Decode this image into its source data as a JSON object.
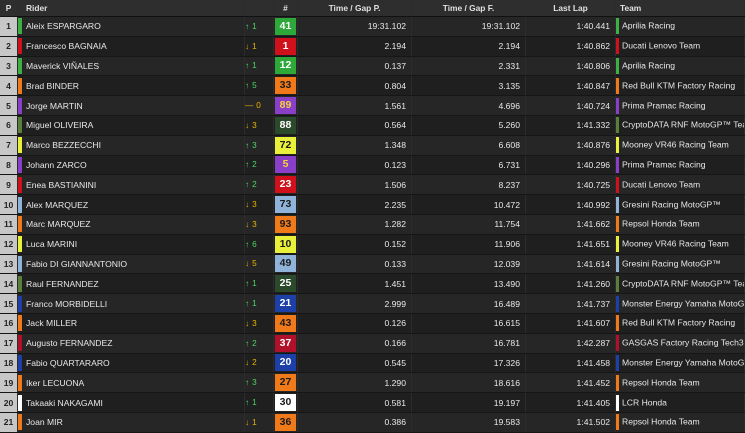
{
  "header": {
    "pos": "P",
    "rider": "Rider",
    "num": "#",
    "gap_p": "Time / Gap P.",
    "gap_f": "Time / Gap F.",
    "last": "Last Lap",
    "team": "Team"
  },
  "colors": {
    "up": "#4cd964",
    "down": "#f0b400"
  },
  "rows": [
    {
      "pos": "1",
      "rider": "Aleix ESPARGARO",
      "dir": "up",
      "chg": "1",
      "num": "41",
      "num_bg": "#2fa83a",
      "num_fg": "#ffffff",
      "gap_p": "19:31.102",
      "gap_f": "19:31.102",
      "last": "1:40.441",
      "team": "Aprilia Racing",
      "team_color": "#3cb043"
    },
    {
      "pos": "2",
      "rider": "Francesco BAGNAIA",
      "dir": "down",
      "chg": "1",
      "num": "1",
      "num_bg": "#d0101a",
      "num_fg": "#ffffff",
      "gap_p": "2.194",
      "gap_f": "2.194",
      "last": "1:40.862",
      "team": "Ducati Lenovo Team",
      "team_color": "#d0101a"
    },
    {
      "pos": "3",
      "rider": "Maverick VIÑALES",
      "dir": "up",
      "chg": "1",
      "num": "12",
      "num_bg": "#2fa83a",
      "num_fg": "#ffffff",
      "gap_p": "0.137",
      "gap_f": "2.331",
      "last": "1:40.806",
      "team": "Aprilia Racing",
      "team_color": "#3cb043"
    },
    {
      "pos": "4",
      "rider": "Brad BINDER",
      "dir": "up",
      "chg": "5",
      "num": "33",
      "num_bg": "#f07a1a",
      "num_fg": "#1a1a1a",
      "gap_p": "0.804",
      "gap_f": "3.135",
      "last": "1:40.847",
      "team": "Red Bull KTM Factory Racing",
      "team_color": "#f07a1a"
    },
    {
      "pos": "5",
      "rider": "Jorge MARTIN",
      "dir": "same",
      "chg": "0",
      "num": "89",
      "num_bg": "#8a3fc9",
      "num_fg": "#f5d23a",
      "gap_p": "1.561",
      "gap_f": "4.696",
      "last": "1:40.724",
      "team": "Prima Pramac Racing",
      "team_color": "#8a3fc9"
    },
    {
      "pos": "6",
      "rider": "Miguel OLIVEIRA",
      "dir": "down",
      "chg": "3",
      "num": "88",
      "num_bg": "#2b4a2b",
      "num_fg": "#ffffff",
      "gap_p": "0.564",
      "gap_f": "5.260",
      "last": "1:41.332",
      "team": "CryptoDATA RNF MotoGP™ Team",
      "team_color": "#5a7f3a"
    },
    {
      "pos": "7",
      "rider": "Marco BEZZECCHI",
      "dir": "up",
      "chg": "3",
      "num": "72",
      "num_bg": "#e8f03a",
      "num_fg": "#1a1a1a",
      "gap_p": "1.348",
      "gap_f": "6.608",
      "last": "1:40.876",
      "team": "Mooney VR46 Racing Team",
      "team_color": "#e8f03a"
    },
    {
      "pos": "8",
      "rider": "Johann ZARCO",
      "dir": "up",
      "chg": "2",
      "num": "5",
      "num_bg": "#8a3fc9",
      "num_fg": "#f5d23a",
      "gap_p": "0.123",
      "gap_f": "6.731",
      "last": "1:40.296",
      "team": "Prima Pramac Racing",
      "team_color": "#8a3fc9"
    },
    {
      "pos": "9",
      "rider": "Enea BASTIANINI",
      "dir": "up",
      "chg": "2",
      "num": "23",
      "num_bg": "#d0101a",
      "num_fg": "#ffffff",
      "gap_p": "1.506",
      "gap_f": "8.237",
      "last": "1:40.725",
      "team": "Ducati Lenovo Team",
      "team_color": "#d0101a"
    },
    {
      "pos": "10",
      "rider": "Alex MARQUEZ",
      "dir": "down",
      "chg": "3",
      "num": "73",
      "num_bg": "#8fb3d9",
      "num_fg": "#1a1a1a",
      "gap_p": "2.235",
      "gap_f": "10.472",
      "last": "1:40.992",
      "team": "Gresini Racing MotoGP™",
      "team_color": "#8fb3d9"
    },
    {
      "pos": "11",
      "rider": "Marc MARQUEZ",
      "dir": "down",
      "chg": "3",
      "num": "93",
      "num_bg": "#f07a1a",
      "num_fg": "#1a1a1a",
      "gap_p": "1.282",
      "gap_f": "11.754",
      "last": "1:41.662",
      "team": "Repsol Honda Team",
      "team_color": "#f07a1a"
    },
    {
      "pos": "12",
      "rider": "Luca MARINI",
      "dir": "up",
      "chg": "6",
      "num": "10",
      "num_bg": "#e8f03a",
      "num_fg": "#1a1a1a",
      "gap_p": "0.152",
      "gap_f": "11.906",
      "last": "1:41.651",
      "team": "Mooney VR46 Racing Team",
      "team_color": "#e8f03a"
    },
    {
      "pos": "13",
      "rider": "Fabio DI GIANNANTONIO",
      "dir": "down",
      "chg": "5",
      "num": "49",
      "num_bg": "#8fb3d9",
      "num_fg": "#1a1a1a",
      "gap_p": "0.133",
      "gap_f": "12.039",
      "last": "1:41.614",
      "team": "Gresini Racing MotoGP™",
      "team_color": "#8fb3d9"
    },
    {
      "pos": "14",
      "rider": "Raul FERNANDEZ",
      "dir": "up",
      "chg": "1",
      "num": "25",
      "num_bg": "#2b4a2b",
      "num_fg": "#ffffff",
      "gap_p": "1.451",
      "gap_f": "13.490",
      "last": "1:41.260",
      "team": "CryptoDATA RNF MotoGP™ Team",
      "team_color": "#5a7f3a"
    },
    {
      "pos": "15",
      "rider": "Franco MORBIDELLI",
      "dir": "up",
      "chg": "1",
      "num": "21",
      "num_bg": "#1c3fa8",
      "num_fg": "#ffffff",
      "gap_p": "2.999",
      "gap_f": "16.489",
      "last": "1:41.737",
      "team": "Monster Energy Yamaha MotoGP™",
      "team_color": "#1c3fa8"
    },
    {
      "pos": "16",
      "rider": "Jack MILLER",
      "dir": "down",
      "chg": "3",
      "num": "43",
      "num_bg": "#f07a1a",
      "num_fg": "#1a1a1a",
      "gap_p": "0.126",
      "gap_f": "16.615",
      "last": "1:41.607",
      "team": "Red Bull KTM Factory Racing",
      "team_color": "#f07a1a"
    },
    {
      "pos": "17",
      "rider": "Augusto FERNANDEZ",
      "dir": "up",
      "chg": "2",
      "num": "37",
      "num_bg": "#b0102a",
      "num_fg": "#ffffff",
      "gap_p": "0.166",
      "gap_f": "16.781",
      "last": "1:42.287",
      "team": "GASGAS Factory Racing Tech3",
      "team_color": "#b0102a"
    },
    {
      "pos": "18",
      "rider": "Fabio QUARTARARO",
      "dir": "down",
      "chg": "2",
      "num": "20",
      "num_bg": "#1c3fa8",
      "num_fg": "#ffffff",
      "gap_p": "0.545",
      "gap_f": "17.326",
      "last": "1:41.458",
      "team": "Monster Energy Yamaha MotoGP™",
      "team_color": "#1c3fa8"
    },
    {
      "pos": "19",
      "rider": "Iker LECUONA",
      "dir": "up",
      "chg": "3",
      "num": "27",
      "num_bg": "#f07a1a",
      "num_fg": "#1a1a1a",
      "gap_p": "1.290",
      "gap_f": "18.616",
      "last": "1:41.452",
      "team": "Repsol Honda Team",
      "team_color": "#f07a1a"
    },
    {
      "pos": "20",
      "rider": "Takaaki NAKAGAMI",
      "dir": "up",
      "chg": "1",
      "num": "30",
      "num_bg": "#ffffff",
      "num_fg": "#1a1a1a",
      "gap_p": "0.581",
      "gap_f": "19.197",
      "last": "1:41.405",
      "team": "LCR Honda",
      "team_color": "#ffffff"
    },
    {
      "pos": "21",
      "rider": "Joan MIR",
      "dir": "down",
      "chg": "1",
      "num": "36",
      "num_bg": "#f07a1a",
      "num_fg": "#1a1a1a",
      "gap_p": "0.386",
      "gap_f": "19.583",
      "last": "1:41.502",
      "team": "Repsol Honda Team",
      "team_color": "#f07a1a"
    }
  ]
}
